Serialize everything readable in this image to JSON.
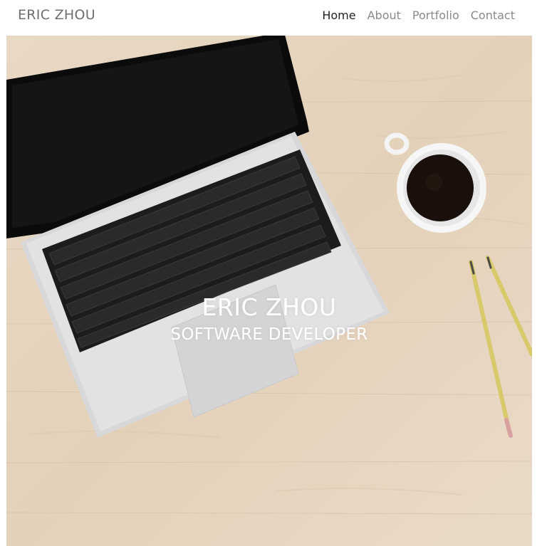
{
  "nav": {
    "brand": "ERIC ZHOU",
    "links": [
      {
        "label": "Home",
        "active": true
      },
      {
        "label": "About",
        "active": false
      },
      {
        "label": "Portfolio",
        "active": false
      },
      {
        "label": "Contact",
        "active": false
      }
    ]
  },
  "hero": {
    "title": "ERIC ZHOU",
    "subtitle": "SOFTWARE DEVELOPER",
    "image_subject": "laptop, coffee cup and pencils on a wooden desk"
  },
  "colors": {
    "brand_text": "#6f6f6f",
    "nav_link": "#8a8a8a",
    "nav_active": "#222222",
    "hero_text": "#ffffff",
    "desk_wood": "#e6d4bf"
  }
}
